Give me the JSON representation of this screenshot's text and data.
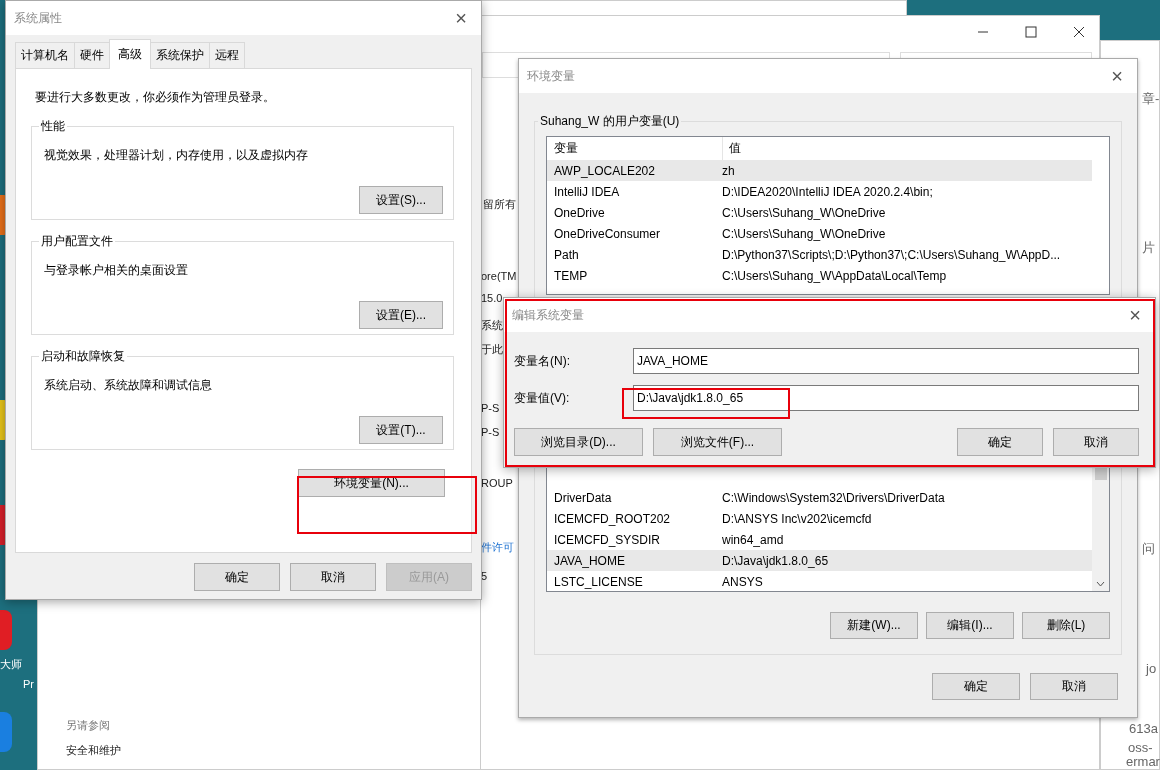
{
  "desktop": {
    "icon_labels": [
      "大师",
      "Pr"
    ]
  },
  "background_window": {
    "fragments": [
      "留所有",
      "ore(TM",
      "15.0",
      "系统",
      "于此",
      "P-S",
      "P-S",
      "ROUP",
      "件许可",
      "5",
      "另请参阅",
      "安全和维护"
    ]
  },
  "browser": {
    "fragments": [
      "章-",
      "片",
      "问",
      "jo",
      "613a",
      "oss-",
      "ermar"
    ]
  },
  "system_properties": {
    "title": "系统属性",
    "close": "×",
    "tabs": [
      {
        "label": "计算机名",
        "selected": false
      },
      {
        "label": "硬件",
        "selected": false
      },
      {
        "label": "高级",
        "selected": true
      },
      {
        "label": "系统保护",
        "selected": false
      },
      {
        "label": "远程",
        "selected": false
      }
    ],
    "notice": "要进行大多数更改，你必须作为管理员登录。",
    "groups": [
      {
        "title": "性能",
        "description": "视觉效果，处理器计划，内存使用，以及虚拟内存",
        "button": "设置(S)..."
      },
      {
        "title": "用户配置文件",
        "description": "与登录帐户相关的桌面设置",
        "button": "设置(E)..."
      },
      {
        "title": "启动和故障恢复",
        "description": "系统启动、系统故障和调试信息",
        "button": "设置(T)..."
      }
    ],
    "env_button": "环境变量(N)...",
    "buttons": [
      {
        "label": "确定",
        "disabled": false
      },
      {
        "label": "取消",
        "disabled": false
      },
      {
        "label": "应用(A)",
        "disabled": true
      }
    ]
  },
  "environment_variables": {
    "title": "环境变量",
    "close": "×",
    "user_group_title": "Suhang_W 的用户变量(U)",
    "columns": [
      "变量",
      "值"
    ],
    "user_rows": [
      {
        "name": "AWP_LOCALE202",
        "value": "zh",
        "selected": true
      },
      {
        "name": "IntelliJ IDEA",
        "value": "D:\\IDEA2020\\IntelliJ IDEA 2020.2.4\\bin;",
        "selected": false
      },
      {
        "name": "OneDrive",
        "value": "C:\\Users\\Suhang_W\\OneDrive",
        "selected": false
      },
      {
        "name": "OneDriveConsumer",
        "value": "C:\\Users\\Suhang_W\\OneDrive",
        "selected": false
      },
      {
        "name": "Path",
        "value": "D:\\Python37\\Scripts\\;D:\\Python37\\;C:\\Users\\Suhang_W\\AppD...",
        "selected": false
      },
      {
        "name": "TEMP",
        "value": "C:\\Users\\Suhang_W\\AppData\\Local\\Temp",
        "selected": false
      }
    ],
    "system_rows": [
      {
        "name": "DriverData",
        "value": "C:\\Windows\\System32\\Drivers\\DriverData",
        "selected": false
      },
      {
        "name": "ICEMCFD_ROOT202",
        "value": "D:\\ANSYS Inc\\v202\\icemcfd",
        "selected": false
      },
      {
        "name": "ICEMCFD_SYSDIR",
        "value": "win64_amd",
        "selected": false
      },
      {
        "name": "JAVA_HOME",
        "value": "D:\\Java\\jdk1.8.0_65",
        "selected": true
      },
      {
        "name": "LSTC_LICENSE",
        "value": "ANSYS",
        "selected": false
      }
    ],
    "system_buttons": [
      "新建(W)...",
      "编辑(I)...",
      "删除(L)"
    ],
    "buttons": [
      "确定",
      "取消"
    ]
  },
  "edit_system_variable": {
    "title": "编辑系统变量",
    "close": "×",
    "fields": [
      {
        "label": "变量名(N):",
        "value": "JAVA_HOME"
      },
      {
        "label": "变量值(V):",
        "value": "D:\\Java\\jdk1.8.0_65"
      }
    ],
    "buttons": [
      "浏览目录(D)...",
      "浏览文件(F)...",
      "确定",
      "取消"
    ]
  }
}
